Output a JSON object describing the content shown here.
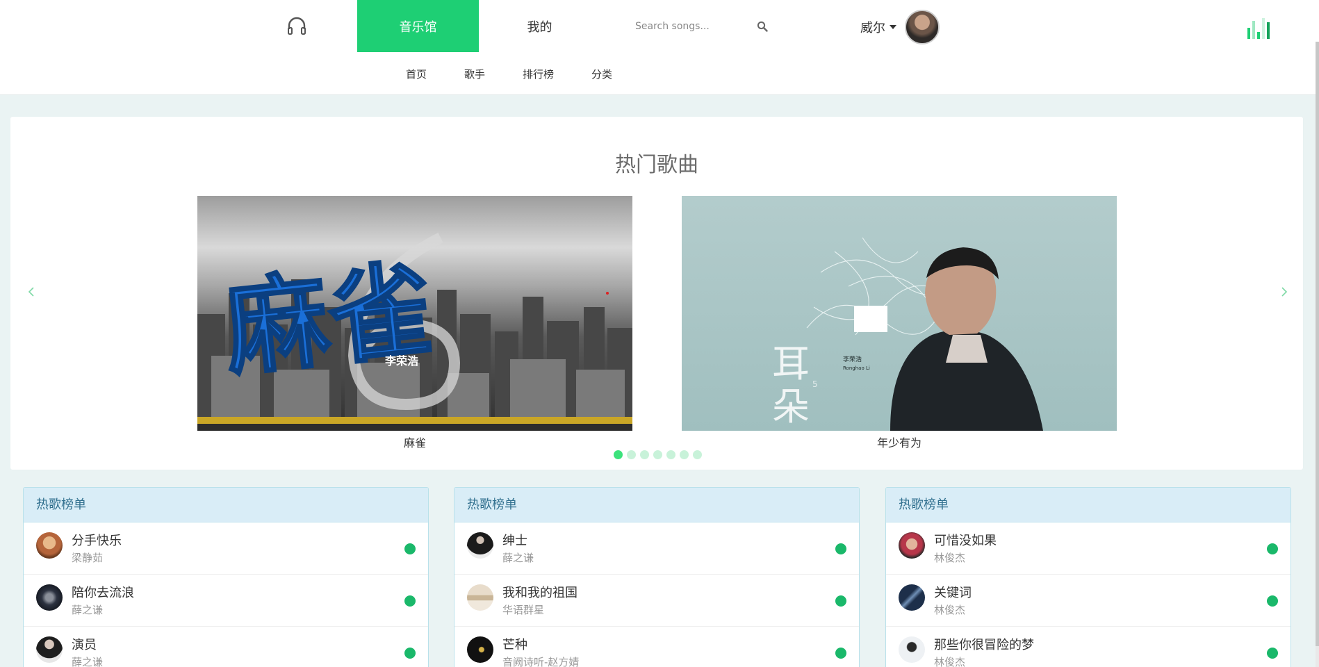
{
  "header": {
    "tabs": [
      {
        "label": "音乐馆",
        "active": true
      },
      {
        "label": "我的",
        "active": false
      }
    ],
    "search": {
      "placeholder": "Search songs..."
    },
    "user": {
      "name": "威尔"
    },
    "subnav": [
      "首页",
      "歌手",
      "排行榜",
      "分类"
    ]
  },
  "carousel": {
    "title": "热门歌曲",
    "slides": [
      {
        "caption": "麻雀",
        "cover_text": "麻雀",
        "cover_artist": "李荣浩"
      },
      {
        "caption": "年少有为",
        "cover_text": "耳朵",
        "cover_artist": "李荣浩",
        "cover_artist_en": "Ronghao Li"
      }
    ],
    "dot_count": 7,
    "active_dot": 0
  },
  "hot_lists": [
    {
      "title": "热歌榜单",
      "songs": [
        {
          "title": "分手快乐",
          "artist": "梁静茹"
        },
        {
          "title": "陪你去流浪",
          "artist": "薛之谦"
        },
        {
          "title": "演员",
          "artist": "薛之谦"
        }
      ]
    },
    {
      "title": "热歌榜单",
      "songs": [
        {
          "title": "绅士",
          "artist": "薛之谦"
        },
        {
          "title": "我和我的祖国",
          "artist": "华语群星"
        },
        {
          "title": "芒种",
          "artist": "音阙诗听-赵方婧"
        }
      ]
    },
    {
      "title": "热歌榜单",
      "songs": [
        {
          "title": "可惜没如果",
          "artist": "林俊杰"
        },
        {
          "title": "关键词",
          "artist": "林俊杰"
        },
        {
          "title": "那些你很冒险的梦",
          "artist": "林俊杰"
        }
      ]
    }
  ],
  "colors": {
    "accent": "#1ecf74",
    "status": "#1ab86a",
    "panel_head": "#d9edf7",
    "panel_head_text": "#31708f"
  }
}
